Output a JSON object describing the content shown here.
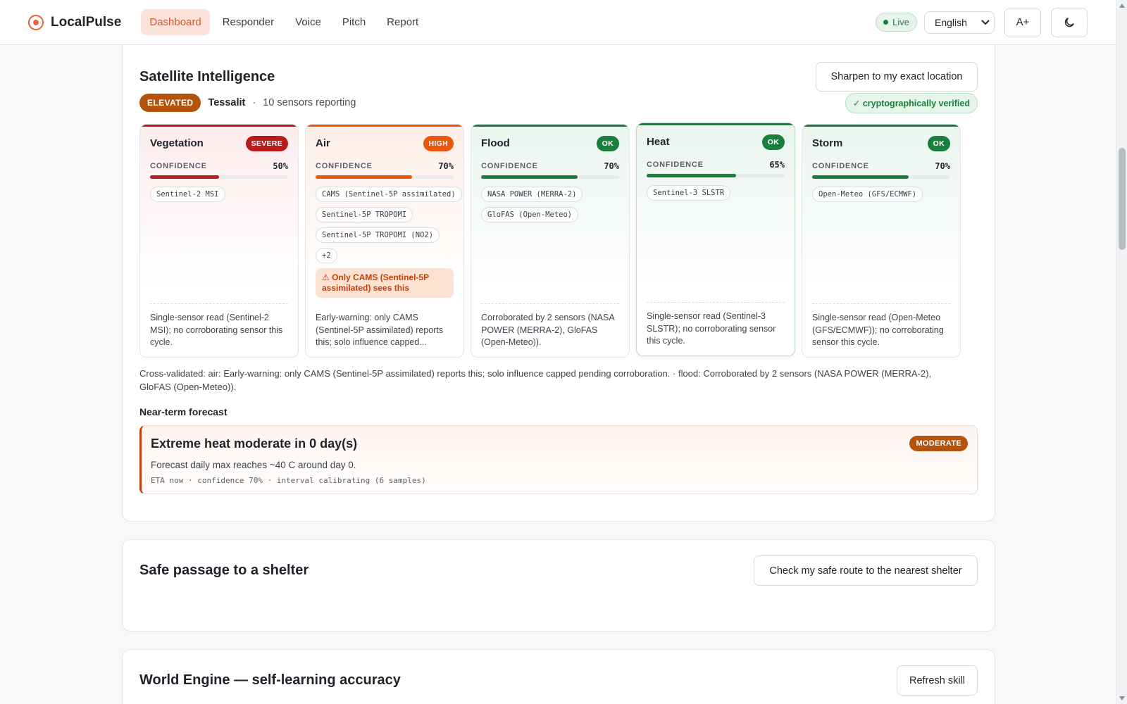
{
  "app": {
    "name": "LocalPulse"
  },
  "nav": {
    "items": [
      {
        "label": "Dashboard",
        "active": true
      },
      {
        "label": "Responder"
      },
      {
        "label": "Voice"
      },
      {
        "label": "Pitch"
      },
      {
        "label": "Report"
      }
    ]
  },
  "header": {
    "live_label": "Live",
    "language": "English",
    "text_size_label": "A+",
    "theme_icon": "moon-icon"
  },
  "satellite": {
    "title": "Satellite Intelligence",
    "sharpen_label": "Sharpen to my exact location",
    "risk_level": "ELEVATED",
    "location": "Tessalit",
    "separator": "·",
    "sensors_text": "10 sensors reporting",
    "verified_label": "✓ cryptographically verified",
    "confidence_label": "CONFIDENCE",
    "hazards": [
      {
        "name": "Vegetation",
        "level": "SEVERE",
        "level_color": "#b91c1c",
        "accent": "#b91c1c",
        "confidence": 50,
        "confidence_text": "50%",
        "sensors": [
          "Sentinel-2 MSI"
        ],
        "note": "",
        "description": "Single-sensor read (Sentinel-2 MSI); no corroborating sensor this cycle."
      },
      {
        "name": "Air",
        "level": "HIGH",
        "level_color": "#ea580c",
        "accent": "#ea580c",
        "confidence": 70,
        "confidence_text": "70%",
        "sensors": [
          "CAMS (Sentinel-5P assimilated)",
          "Sentinel-5P TROPOMI",
          "Sentinel-5P TROPOMI (NO2)",
          "+2"
        ],
        "note": "⚠ Only CAMS (Sentinel-5P assimilated) sees this",
        "description": "Early-warning: only CAMS (Sentinel-5P assimilated) reports this; solo influence capped..."
      },
      {
        "name": "Flood",
        "level": "OK",
        "level_color": "#1a7f3c",
        "accent": "#1a7f3c",
        "confidence": 70,
        "confidence_text": "70%",
        "sensors": [
          "NASA POWER (MERRA-2)",
          "GloFAS (Open-Meteo)"
        ],
        "note": "",
        "description": "Corroborated by 2 sensors (NASA POWER (MERRA-2), GloFAS (Open-Meteo))."
      },
      {
        "name": "Heat",
        "level": "OK",
        "level_color": "#1a7f3c",
        "accent": "#1a7f3c",
        "confidence": 65,
        "confidence_text": "65%",
        "sensors": [
          "Sentinel-3 SLSTR"
        ],
        "note": "",
        "description": "Single-sensor read (Sentinel-3 SLSTR); no corroborating sensor this cycle."
      },
      {
        "name": "Storm",
        "level": "OK",
        "level_color": "#1a7f3c",
        "accent": "#1a7f3c",
        "confidence": 70,
        "confidence_text": "70%",
        "sensors": [
          "Open-Meteo (GFS/ECMWF)"
        ],
        "note": "",
        "description": "Single-sensor read (Open-Meteo (GFS/ECMWF)); no corroborating sensor this cycle."
      }
    ],
    "cross_validated": "Cross-validated: air: Early-warning: only CAMS (Sentinel-5P assimilated) reports this; solo influence capped pending corroboration. · flood: Corroborated by 2 sensors (NASA POWER (MERRA-2), GloFAS (Open-Meteo)).",
    "forecast": {
      "section_label": "Near-term forecast",
      "title": "Extreme heat moderate in 0 day(s)",
      "badge": "MODERATE",
      "summary": "Forecast daily max reaches ~40 C around day 0.",
      "meta": "ETA now · confidence 70% · interval calibrating (6 samples)"
    }
  },
  "shelter": {
    "title": "Safe passage to a shelter",
    "route_label": "Check my safe route to the nearest shelter"
  },
  "world_engine": {
    "title": "World Engine — self-learning accuracy",
    "refresh_label": "Refresh skill"
  },
  "colors": {
    "accent": "#e8603c",
    "elevated": "#b45309",
    "severe": "#b91c1c",
    "high": "#ea580c",
    "ok": "#1a7f3c"
  }
}
